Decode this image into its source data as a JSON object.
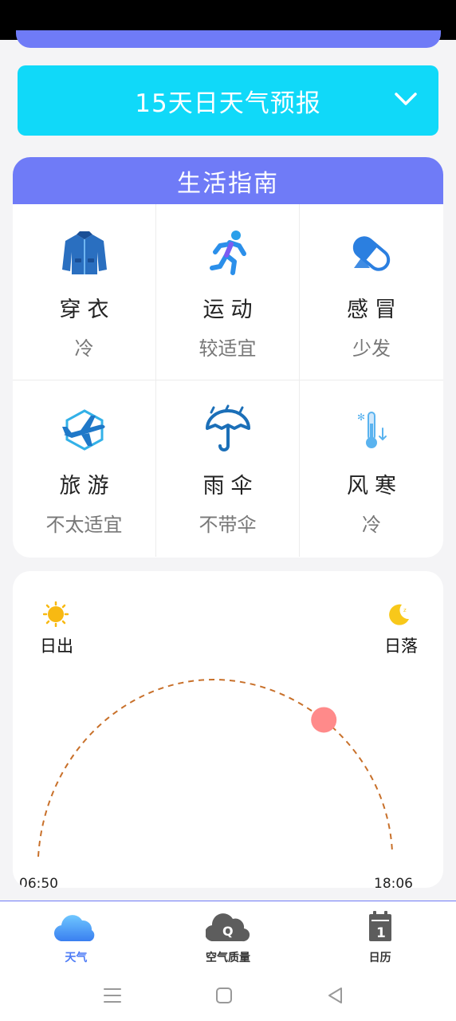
{
  "forecast": {
    "label": "15天日天气预报",
    "icon": "chevron-down-icon"
  },
  "guide": {
    "title": "生活指南",
    "items": [
      {
        "title": "穿衣",
        "value": "冷",
        "icon": "jacket-icon"
      },
      {
        "title": "运动",
        "value": "较适宜",
        "icon": "running-icon"
      },
      {
        "title": "感冒",
        "value": "少发",
        "icon": "pill-icon"
      },
      {
        "title": "旅游",
        "value": "不太适宜",
        "icon": "airplane-icon"
      },
      {
        "title": "雨伞",
        "value": "不带伞",
        "icon": "umbrella-icon"
      },
      {
        "title": "风寒",
        "value": "冷",
        "icon": "thermometer-icon"
      }
    ]
  },
  "sun": {
    "sunrise_label": "日出",
    "sunset_label": "日落",
    "sunrise_time": "06:50",
    "sunset_time": "18:06",
    "day_progress": 0.72,
    "colors": {
      "arc": "#c8702a",
      "sun_dot": "#ff8a8a",
      "sun_icon": "#f8b912",
      "moon_icon": "#f8c81a"
    }
  },
  "tabs": [
    {
      "label": "天气",
      "icon": "cloud-icon",
      "active": true
    },
    {
      "label": "空气质量",
      "icon": "air-quality-cloud-icon",
      "active": false
    },
    {
      "label": "日历",
      "icon": "calendar-icon",
      "active": false
    }
  ],
  "colors": {
    "accent": "#6f7bf7",
    "forecast_button": "#10d9f9",
    "active_tab": "#4e7cf6"
  }
}
